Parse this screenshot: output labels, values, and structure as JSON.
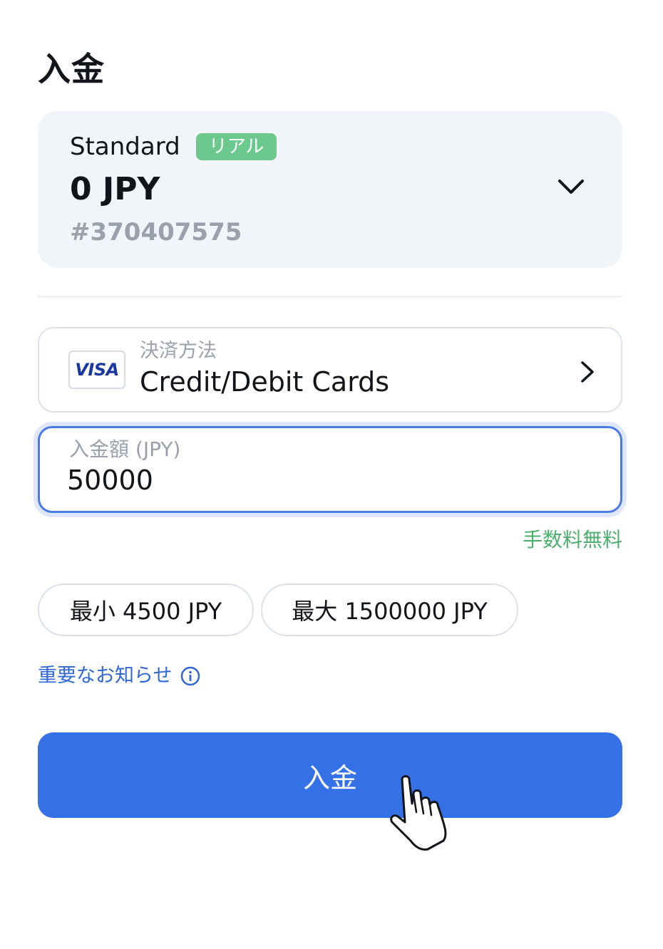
{
  "page": {
    "title": "入金"
  },
  "account": {
    "type": "Standard",
    "badge": "リアル",
    "balance": "0 JPY",
    "number": "#370407575",
    "expand_icon": "chevron-down-icon"
  },
  "payment_method": {
    "label": "決済方法",
    "value": "Credit/Debit Cards",
    "logo_text": "VISA",
    "navigate_icon": "chevron-right-icon"
  },
  "amount": {
    "label": "入金額 (JPY)",
    "value": "50000",
    "fee_note": "手数料無料"
  },
  "limits": {
    "min": "最小 4500 JPY",
    "max": "最大 1500000 JPY"
  },
  "notice": {
    "label": "重要なお知らせ",
    "icon": "info-icon"
  },
  "submit": {
    "label": "入金"
  },
  "colors": {
    "primary": "#3470e6",
    "badge_green": "#6cc98e",
    "fee_green": "#4caf6e",
    "link_blue": "#2f66d6",
    "card_bg": "#f1f4f9",
    "muted_text": "#9aa1ac"
  }
}
